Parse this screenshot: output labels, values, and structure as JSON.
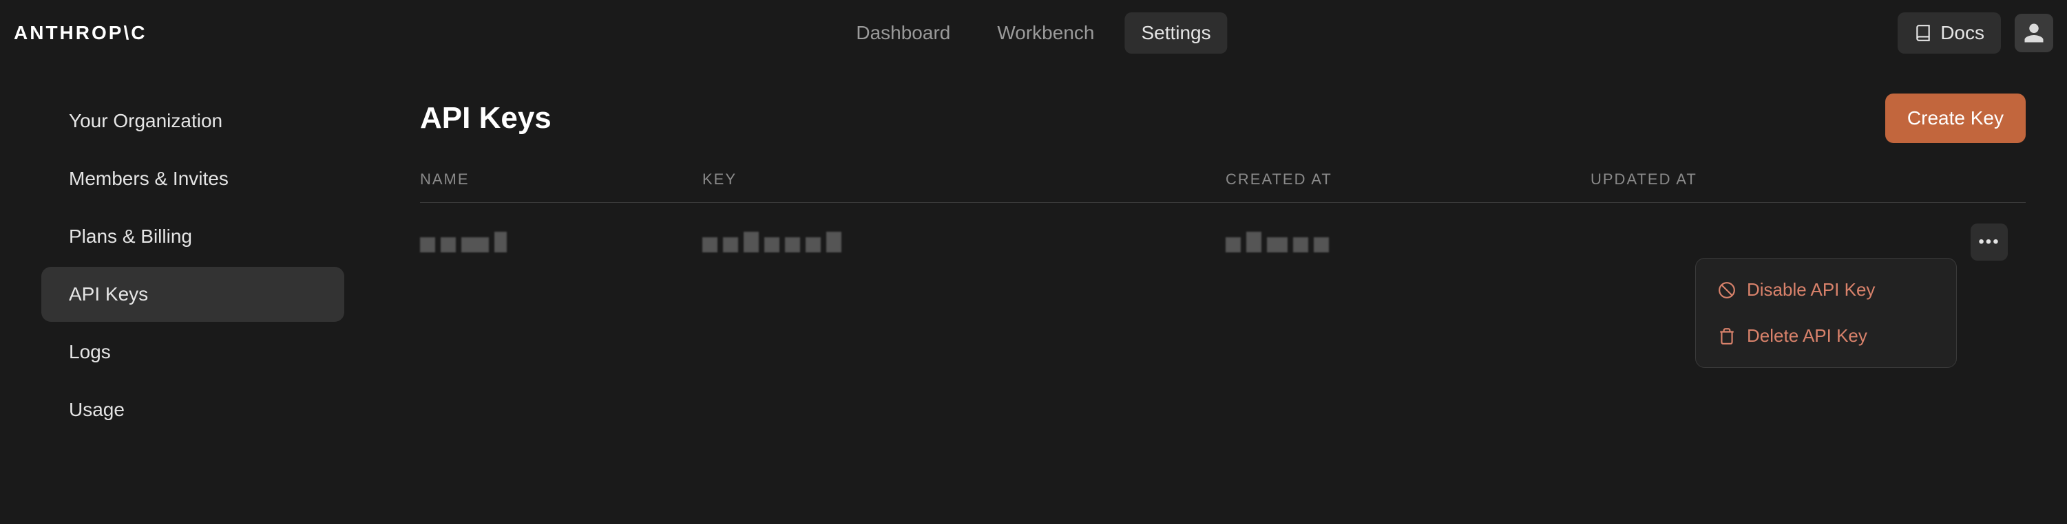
{
  "brand": "ANTHROP\\C",
  "nav": {
    "dashboard": "Dashboard",
    "workbench": "Workbench",
    "settings": "Settings"
  },
  "docs_label": "Docs",
  "sidebar": {
    "items": [
      {
        "label": "Your Organization"
      },
      {
        "label": "Members & Invites"
      },
      {
        "label": "Plans & Billing"
      },
      {
        "label": "API Keys"
      },
      {
        "label": "Logs"
      },
      {
        "label": "Usage"
      }
    ]
  },
  "page": {
    "title": "API Keys",
    "create_button": "Create Key"
  },
  "table": {
    "headers": {
      "name": "NAME",
      "key": "KEY",
      "created": "CREATED AT",
      "updated": "UPDATED AT"
    }
  },
  "dropdown": {
    "disable": "Disable API Key",
    "delete": "Delete API Key"
  },
  "colors": {
    "accent": "#c2663d",
    "danger": "#d9826b"
  }
}
